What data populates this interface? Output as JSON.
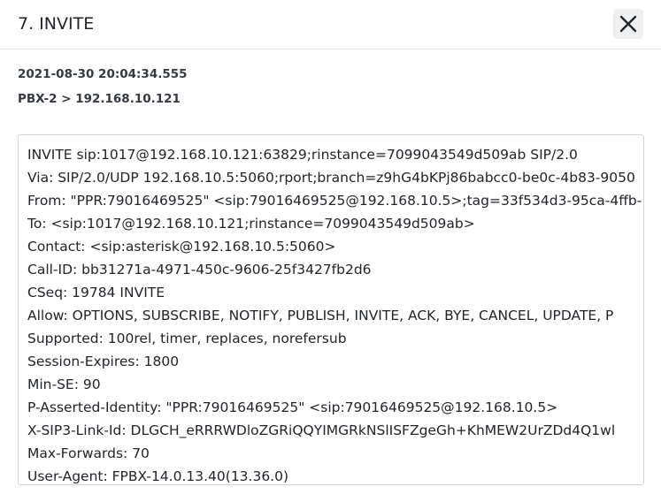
{
  "dialog": {
    "title": "7. INVITE",
    "close_icon": "close-icon"
  },
  "meta": {
    "timestamp": "2021-08-30 20:04:34.555",
    "route": "PBX-2 > 192.168.10.121"
  },
  "sip_message": {
    "lines": [
      "INVITE sip:1017@192.168.10.121:63829;rinstance=7099043549d509ab SIP/2.0",
      "Via: SIP/2.0/UDP 192.168.10.5:5060;rport;branch=z9hG4bKPj86babcc0-be0c-4b83-9050",
      "From: \"PPR:79016469525\" <sip:79016469525@192.168.10.5>;tag=33f534d3-95ca-4ffb-",
      "To: <sip:1017@192.168.10.121;rinstance=7099043549d509ab>",
      "Contact: <sip:asterisk@192.168.10.5:5060>",
      "Call-ID: bb31271a-4971-450c-9606-25f3427fb2d6",
      "CSeq: 19784 INVITE",
      "Allow: OPTIONS, SUBSCRIBE, NOTIFY, PUBLISH, INVITE, ACK, BYE, CANCEL, UPDATE, P",
      "Supported: 100rel, timer, replaces, norefersub",
      "Session-Expires: 1800",
      "Min-SE: 90",
      "P-Asserted-Identity: \"PPR:79016469525\" <sip:79016469525@192.168.10.5>",
      "X-SIP3-Link-Id: DLGCH_eRRRWDloZGRiQQYIMGRkNSlISFZgeGh+KhMEW2UrZDd4Q1wl",
      "Max-Forwards: 70",
      "User-Agent: FPBX-14.0.13.40(13.36.0)"
    ]
  }
}
